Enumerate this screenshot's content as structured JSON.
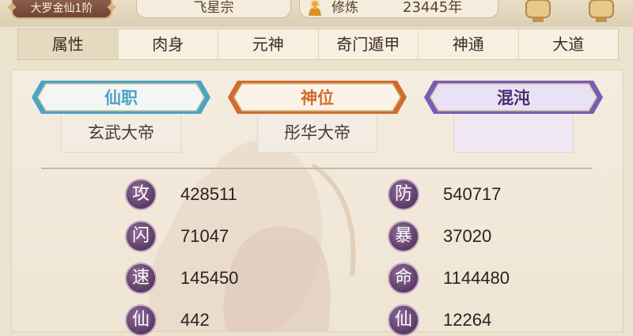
{
  "header": {
    "rank": "大罗金仙1阶",
    "sect": "飞星宗",
    "cultivation_label": "修炼",
    "cultivation_value": "23445年"
  },
  "tabs": [
    "属性",
    "肉身",
    "元神",
    "奇门遁甲",
    "神通",
    "大道"
  ],
  "active_tab": 0,
  "titles": [
    {
      "label": "仙职",
      "value": "玄武大帝",
      "accent": "#4aa4c4"
    },
    {
      "label": "神位",
      "value": "彤华大帝",
      "accent": "#d26b2c"
    },
    {
      "label": "混沌",
      "value": "",
      "accent": "#7a5bb5"
    }
  ],
  "stats": [
    {
      "label": "攻",
      "value": "428511"
    },
    {
      "label": "防",
      "value": "540717"
    },
    {
      "label": "闪",
      "value": "71047"
    },
    {
      "label": "暴",
      "value": "37020"
    },
    {
      "label": "速",
      "value": "145450"
    },
    {
      "label": "命",
      "value": "1144480"
    },
    {
      "label": "仙",
      "value": "442"
    },
    {
      "label": "仙",
      "value": "12264"
    }
  ]
}
